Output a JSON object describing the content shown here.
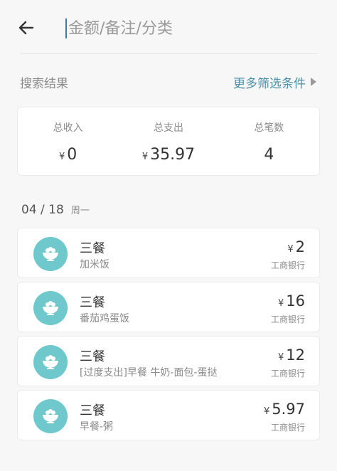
{
  "search": {
    "placeholder": "金额/备注/分类",
    "value": ""
  },
  "results": {
    "title": "搜索结果",
    "more_filters_label": "更多筛选条件"
  },
  "summary": [
    {
      "label": "总收入",
      "currency": "¥",
      "value": "0"
    },
    {
      "label": "总支出",
      "currency": "¥",
      "value": "35.97"
    },
    {
      "label": "总笔数",
      "currency": "",
      "value": "4"
    }
  ],
  "date_group": {
    "date": "04 / 18",
    "weekday": "周一"
  },
  "transactions": [
    {
      "category": "三餐",
      "note": "加米饭",
      "currency": "¥",
      "amount": "2",
      "account": "工商银行",
      "icon": "rice-bowl-icon"
    },
    {
      "category": "三餐",
      "note": "番茄鸡蛋饭",
      "currency": "¥",
      "amount": "16",
      "account": "工商银行",
      "icon": "rice-bowl-icon"
    },
    {
      "category": "三餐",
      "note": "[过度支出]早餐 牛奶-面包-蛋挞",
      "currency": "¥",
      "amount": "12",
      "account": "工商银行",
      "icon": "rice-bowl-icon"
    },
    {
      "category": "三餐",
      "note": "早餐-粥",
      "currency": "¥",
      "amount": "5.97",
      "account": "工商银行",
      "icon": "rice-bowl-icon"
    }
  ],
  "colors": {
    "accent": "#4a8fa8",
    "icon_bg": "#6fc8cc",
    "background": "#f7f7f7"
  }
}
